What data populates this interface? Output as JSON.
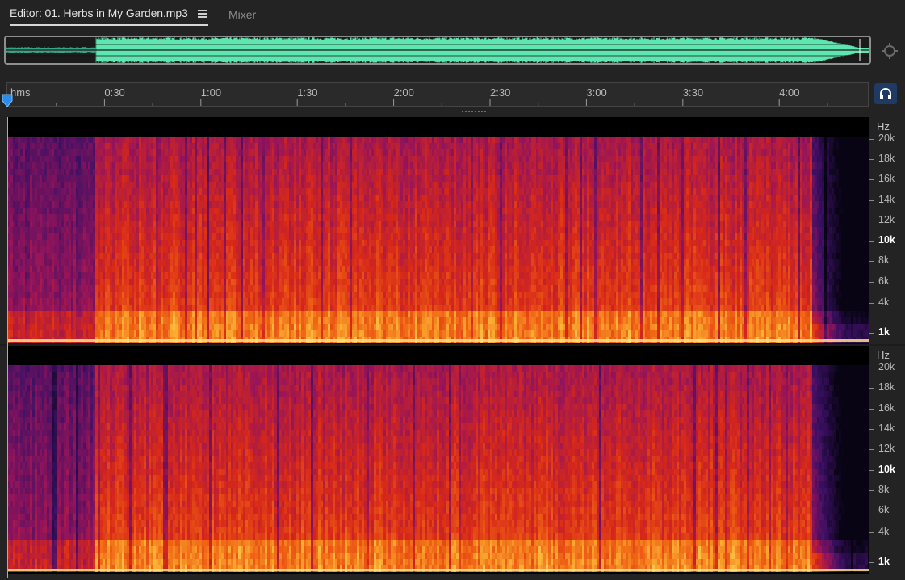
{
  "tabs": {
    "editor_label": "Editor: 01. Herbs in My Garden.mp3",
    "mixer_label": "Mixer"
  },
  "ruler": {
    "unit_label": "hms",
    "time_labels": [
      "0:30",
      "1:00",
      "1:30",
      "2:00",
      "2:30",
      "3:00",
      "3:30",
      "4:00"
    ]
  },
  "frequency_scale": {
    "unit_label": "Hz",
    "ticks": [
      {
        "label": "20k",
        "bold": false
      },
      {
        "label": "18k",
        "bold": false
      },
      {
        "label": "16k",
        "bold": false
      },
      {
        "label": "14k",
        "bold": false
      },
      {
        "label": "12k",
        "bold": false
      },
      {
        "label": "10k",
        "bold": true
      },
      {
        "label": "8k",
        "bold": false
      },
      {
        "label": "6k",
        "bold": false
      },
      {
        "label": "4k",
        "bold": false
      },
      {
        "label": "1k",
        "bold": true
      }
    ]
  },
  "icons": {
    "tab_menu": "hamburger-icon",
    "zoom": "zoom-target-icon",
    "headphones": "headphones-icon",
    "playhead": "playhead-marker-icon"
  },
  "colors": {
    "waveform": "#5ee6b0",
    "headphone_button": "#1f3a63",
    "playhead": "#2d8ceb",
    "spectrogram_low": "#f5c04a",
    "spectrogram_mid": "#e03a16",
    "spectrogram_high": "#4a1568"
  }
}
